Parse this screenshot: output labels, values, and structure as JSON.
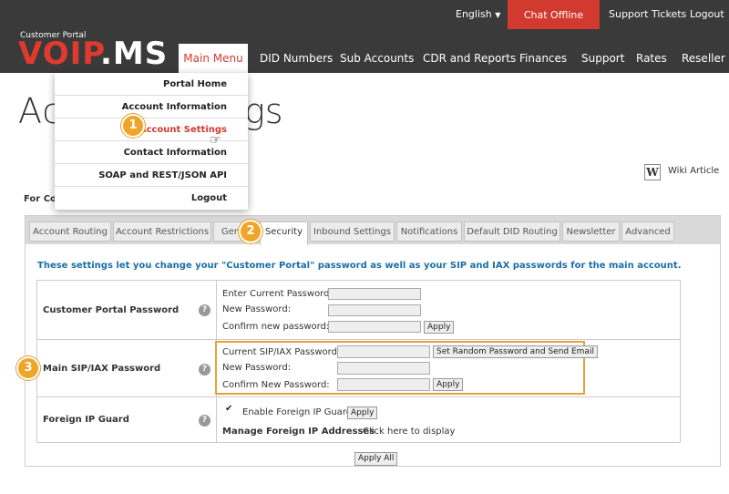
{
  "header": {
    "language": "English",
    "chat": "Chat Offline",
    "support_tickets": "Support Tickets",
    "logout": "Logout",
    "logo_sub": "Customer Portal",
    "logo_main": "VOIP",
    "logo_suffix": ".MS"
  },
  "nav": {
    "main_menu": "Main Menu",
    "did_numbers": "DID Numbers",
    "sub_accounts": "Sub Accounts",
    "cdr": "CDR and Reports",
    "finances": "Finances",
    "support": "Support",
    "rates": "Rates",
    "reseller": "Reseller"
  },
  "page_title": "Ac",
  "page_title_tail": "gs",
  "dropdown": {
    "items": [
      "Portal Home",
      "Account Information",
      "Account Settings",
      "Contact Information",
      "SOAP and REST/JSON API",
      "Logout"
    ]
  },
  "wiki": {
    "icon": "W",
    "label": "Wiki Article"
  },
  "for_label": "For Co",
  "tabs": [
    "Account Routing",
    "Account Restrictions",
    "Gen",
    "Security",
    "Inbound Settings",
    "Notifications",
    "Default DID Routing",
    "Newsletter",
    "Advanced"
  ],
  "description": "These settings let you change your \"Customer Portal\" password as well as your SIP and IAX passwords for the main account.",
  "sections": {
    "portal": {
      "label": "Customer Portal Password",
      "current": "Enter Current Password:",
      "new": "New Password:",
      "confirm": "Confirm new password:",
      "apply": "Apply"
    },
    "sip": {
      "label": "Main SIP/IAX Password",
      "current": "Current SIP/IAX Password:",
      "random_btn": "Set Random Password and Send Email",
      "new": "New Password:",
      "confirm": "Confirm New Password:",
      "apply": "Apply"
    },
    "guard": {
      "label": "Foreign IP Guard",
      "enable": "Enable Foreign IP Guard",
      "apply": "Apply",
      "manage_label": "Manage Foreign IP Addresses",
      "manage_link": "Click here to display"
    }
  },
  "apply_all": "Apply All",
  "help_glyph": "?",
  "badges": [
    "1",
    "2",
    "3"
  ],
  "colors": {
    "accent_red": "#d23a2f",
    "header_bg": "#3a3a3a",
    "highlight": "#e8a13a",
    "badge": "#f0a52a",
    "link_blue": "#1a6fa8"
  }
}
